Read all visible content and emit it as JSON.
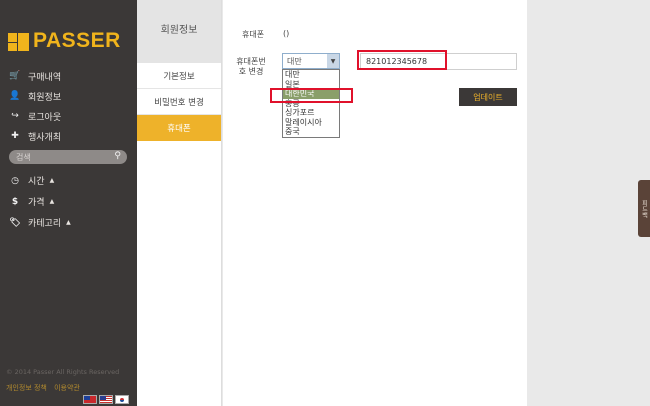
{
  "brand": {
    "name": "PASSER"
  },
  "sidebar": {
    "nav": [
      {
        "label": "구매내역",
        "icon": "cart-icon",
        "glyph": "🛒"
      },
      {
        "label": "회원정보",
        "icon": "user-icon",
        "glyph": "👤"
      },
      {
        "label": "로그아웃",
        "icon": "logout-icon",
        "glyph": "↪"
      },
      {
        "label": "행사개최",
        "icon": "plus-icon",
        "glyph": "✚"
      }
    ],
    "search": {
      "placeholder": "검색"
    },
    "filters": [
      {
        "label": "시간",
        "icon": "clock-icon",
        "glyph": "◷"
      },
      {
        "label": "가격",
        "icon": "dollar-icon",
        "glyph": "$"
      },
      {
        "label": "카테고리",
        "icon": "tag-icon",
        "glyph": "🏷"
      }
    ],
    "copyright": "© 2014 Passer All Rights Reserved",
    "footer_links": [
      "개인정보 정책",
      "이용약관"
    ]
  },
  "submenu": {
    "title": "회원정보",
    "items": [
      {
        "label": "기본정보",
        "active": false
      },
      {
        "label": "비밀번호 변경",
        "active": false
      },
      {
        "label": "휴대폰",
        "active": true
      }
    ]
  },
  "form": {
    "phone_label": "휴대폰",
    "phone_value": "()",
    "change_label": "휴대폰번호 변경",
    "country_select_value": "대만",
    "country_options": [
      "대만",
      "일본",
      "대한민국",
      "홍콩",
      "싱가포르",
      "말레이시아",
      "중국"
    ],
    "selected_option_index": 2,
    "phone_input_value": "821012345678",
    "update_label": "업데이트"
  },
  "side_tab": {
    "label": "피드백"
  },
  "colors": {
    "accent": "#eeb22a",
    "sidebar": "#3b3837",
    "highlight": "#e0112b"
  }
}
